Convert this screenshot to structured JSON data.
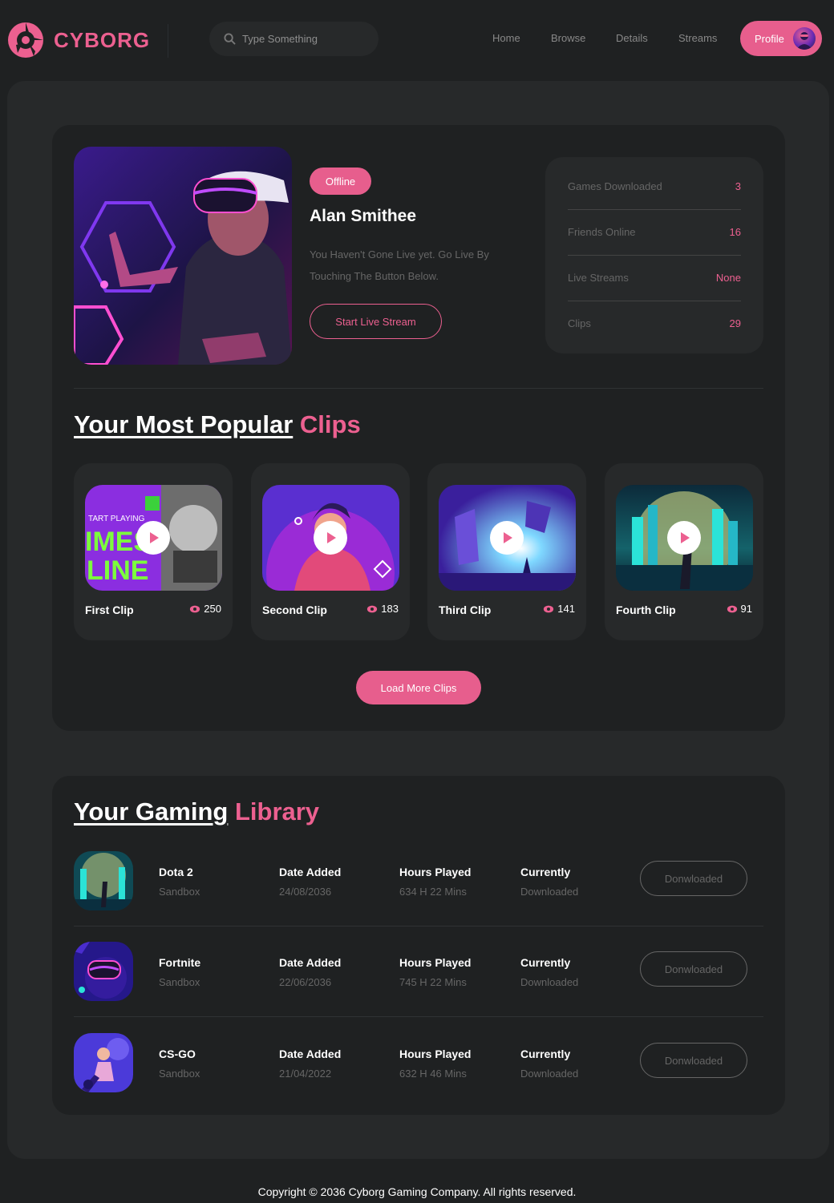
{
  "brand": {
    "name": "CYBORG",
    "accent": "#ec6090"
  },
  "search": {
    "placeholder": "Type Something"
  },
  "nav": {
    "items": [
      "Home",
      "Browse",
      "Details",
      "Streams"
    ],
    "profile_label": "Profile"
  },
  "hero": {
    "status": "Offline",
    "name": "Alan Smithee",
    "description": "You Haven't Gone Live yet. Go Live By Touching The Button Below.",
    "cta": "Start Live Stream"
  },
  "stats": [
    {
      "label": "Games Downloaded",
      "value": "3"
    },
    {
      "label": "Friends Online",
      "value": "16"
    },
    {
      "label": "Live Streams",
      "value": "None"
    },
    {
      "label": "Clips",
      "value": "29"
    }
  ],
  "clips_section": {
    "title_white": "Your Most Popular",
    "title_pink": "Clips",
    "load_more": "Load More Clips"
  },
  "clips": [
    {
      "title": "First Clip",
      "views": "250"
    },
    {
      "title": "Second Clip",
      "views": "183"
    },
    {
      "title": "Third Clip",
      "views": "141"
    },
    {
      "title": "Fourth Clip",
      "views": "91"
    }
  ],
  "library_section": {
    "title_white": "Your Gaming",
    "title_pink": "Library"
  },
  "library": [
    {
      "name": "Dota 2",
      "genre": "Sandbox",
      "date_label": "Date Added",
      "date": "24/08/2036",
      "hours_label": "Hours Played",
      "hours": "634 H 22 Mins",
      "status_label": "Currently",
      "status": "Downloaded",
      "button": "Donwloaded"
    },
    {
      "name": "Fortnite",
      "genre": "Sandbox",
      "date_label": "Date Added",
      "date": "22/06/2036",
      "hours_label": "Hours Played",
      "hours": "745 H 22 Mins",
      "status_label": "Currently",
      "status": "Downloaded",
      "button": "Donwloaded"
    },
    {
      "name": "CS-GO",
      "genre": "Sandbox",
      "date_label": "Date Added",
      "date": "21/04/2022",
      "hours_label": "Hours Played",
      "hours": "632 H 46 Mins",
      "status_label": "Currently",
      "status": "Downloaded",
      "button": "Donwloaded"
    }
  ],
  "footer": {
    "text": "Copyright © 2036 Cyborg Gaming Company. All rights reserved."
  }
}
